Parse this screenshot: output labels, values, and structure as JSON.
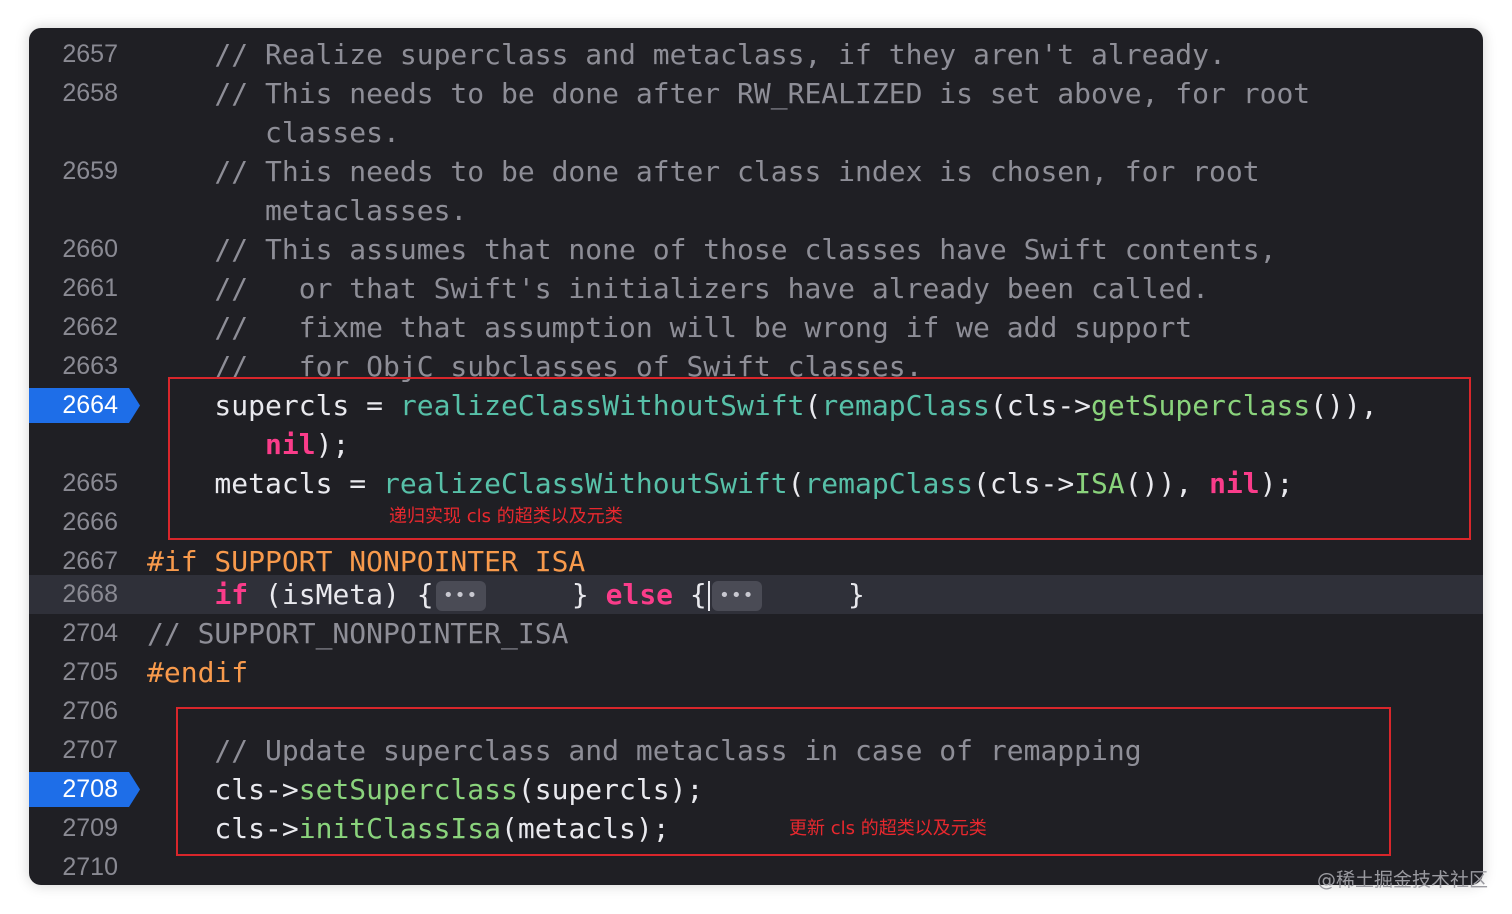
{
  "editor": {
    "lines": [
      {
        "no": "2657",
        "code": "    // Realize superclass and metaclass, if they aren't already."
      },
      {
        "no": "2658",
        "code": "    // This needs to be done after RW_REALIZED is set above, for root"
      },
      {
        "no": "",
        "code": "       classes."
      },
      {
        "no": "2659",
        "code": "    // This needs to be done after class index is chosen, for root"
      },
      {
        "no": "",
        "code": "       metaclasses."
      },
      {
        "no": "2660",
        "code": "    // This assumes that none of those classes have Swift contents,"
      },
      {
        "no": "2661",
        "code": "    //   or that Swift's initializers have already been called."
      },
      {
        "no": "2662",
        "code": "    //   fixme that assumption will be wrong if we add support"
      },
      {
        "no": "2663",
        "code": "    //   for ObjC subclasses of Swift classes."
      },
      {
        "no": "2664",
        "code_prefix": "    supercls = ",
        "func": "realizeClassWithoutSwift",
        "p1": "(",
        "func2": "remapClass",
        "p2": "(cls->",
        "method": "getSuperclass",
        "tail": "()),",
        "breakpoint": true
      },
      {
        "no": "",
        "code_indent": "       ",
        "kw": "nil",
        "tail": ");"
      },
      {
        "no": "2665",
        "code_prefix": "    metacls = ",
        "func": "realizeClassWithoutSwift",
        "p1": "(",
        "func2": "remapClass",
        "p2": "(cls->",
        "method": "ISA",
        "mid": "()), ",
        "kw": "nil",
        "tail": ");"
      },
      {
        "no": "2666",
        "code": ""
      },
      {
        "no": "2667",
        "pre": "#if SUPPORT_NONPOINTER_ISA"
      },
      {
        "no": "2668",
        "indent": "    ",
        "kw1": "if",
        "t1": " (isMeta) {",
        "fold1": "•••",
        "t2": "     } ",
        "kw2": "else",
        "t3": " {",
        "fold2": "•••",
        "t4": "     }",
        "highlight": true
      },
      {
        "no": "2704",
        "comment": "// SUPPORT_NONPOINTER_ISA"
      },
      {
        "no": "2705",
        "pre": "#endif"
      },
      {
        "no": "2706",
        "code": ""
      },
      {
        "no": "2707",
        "code": "    // Update superclass and metaclass in case of remapping"
      },
      {
        "no": "2708",
        "code_prefix": "    cls->",
        "method": "setSuperclass",
        "tail": "(supercls);",
        "breakpoint": true
      },
      {
        "no": "2709",
        "code_prefix": "    cls->",
        "method": "initClassIsa",
        "tail": "(metacls);"
      },
      {
        "no": "2710",
        "code": ""
      }
    ]
  },
  "annotations": {
    "note1": "递归实现 cls 的超类以及元类",
    "note2": "更新 cls 的超类以及元类"
  },
  "colors": {
    "background": "#1f1f24",
    "comment": "#8e8e97",
    "function": "#57c0a8",
    "method": "#8ad37c",
    "keyword": "#fa3c8a",
    "preprocessor": "#f89a4c",
    "breakpoint": "#1e6ee8",
    "annotation_red": "#d8262b"
  },
  "watermark": "@稀土掘金技术社区"
}
